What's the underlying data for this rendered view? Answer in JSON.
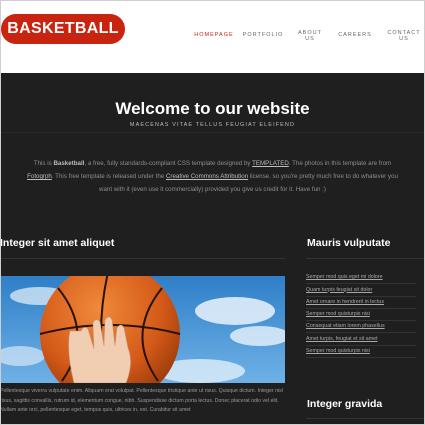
{
  "header": {
    "logo": "BASKETBALL",
    "nav": [
      {
        "lines": [
          "HOMEPAGE"
        ]
      },
      {
        "lines": [
          "PORTFOLIO"
        ]
      },
      {
        "lines": [
          "ABOUT",
          "US"
        ]
      },
      {
        "lines": [
          "CAREERS"
        ]
      },
      {
        "lines": [
          "CONTACT",
          "US"
        ]
      }
    ]
  },
  "welcome": {
    "title": "Welcome to our website",
    "subtitle": "MAECENAS VITAE TELLUS FEUGIAT ELEIFEND"
  },
  "intro": {
    "p1": "This is ",
    "brand": "Basketball",
    "p2": ", a free, fully standards-compliant CSS template designed by ",
    "link1": "TEMPLATED",
    "p3": ". The photos in this template are from ",
    "link2": "Fotogrph",
    "p4": ". This free template is released under the ",
    "link3": "Creative Commons Attribution",
    "p5": " license, so you're pretty much free to do whatever you want with it (even use it commercially) provided you give us credit for it. Have fun :)"
  },
  "main": {
    "heading": "Integer sit amet aliquet",
    "text": "Pellentesque viverra vulputate enim. Aliquam erat volutpat. Pellentesque tristique ante ut risus. Quisque dictum. Integer nisl risus, sagittis convallis, rutrum id, elementum congue, nibh. Suspendisse dictum porta lectus. Donec placerat odio vel elit. Nullam ante orci, pellentesque eget, tempus quis, ultrices in, est. Curabitur sit amet"
  },
  "sidebar": {
    "heading1": "Mauris vulputate",
    "links": [
      "Semper mod quis eget mi dolore",
      "Quam turpis feugiat sit dolor",
      "Amet ornare in hendrerit in lectus",
      "Semper mod quisturpis nisi",
      "Consequat etiam lorem phasellus",
      "Amet turpis, feugiat et sit amet",
      "Semper mod quisturpis nisi"
    ],
    "heading2": "Integer gravida"
  },
  "colors": {
    "accent": "#c8240f",
    "background": "#1f1f1f",
    "header_bg": "#ffffff"
  }
}
